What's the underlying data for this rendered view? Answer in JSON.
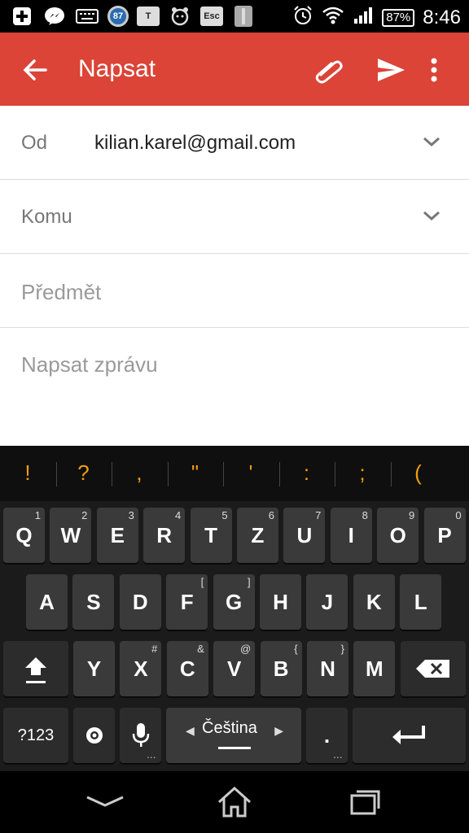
{
  "status_bar": {
    "left_icons": [
      "plus-icon",
      "messenger-icon",
      "keyboard-icon",
      "notification-badge",
      "t-app-icon",
      "alarm-app-icon",
      "esc-key-icon",
      "app-icon"
    ],
    "badge_count": "87",
    "t_label": "T",
    "esc_label": "Esc",
    "battery": "87%",
    "time": "8:46"
  },
  "app_bar": {
    "title": "Napsat",
    "color": "#db4437"
  },
  "compose": {
    "from_label": "Od",
    "from_value": "kilian.karel@gmail.com",
    "to_label": "Komu",
    "subject_placeholder": "Předmět",
    "body_placeholder": "Napsat zprávu"
  },
  "keyboard": {
    "suggestions": [
      "!",
      "?",
      ",",
      "\"",
      "'",
      ":",
      ";",
      "("
    ],
    "row1": [
      {
        "k": "Q",
        "h": "1"
      },
      {
        "k": "W",
        "h": "2"
      },
      {
        "k": "E",
        "h": "3"
      },
      {
        "k": "R",
        "h": "4"
      },
      {
        "k": "T",
        "h": "5"
      },
      {
        "k": "Z",
        "h": "6"
      },
      {
        "k": "U",
        "h": "7"
      },
      {
        "k": "I",
        "h": "8"
      },
      {
        "k": "O",
        "h": "9"
      },
      {
        "k": "P",
        "h": "0"
      }
    ],
    "row2": [
      {
        "k": "A",
        "h": ""
      },
      {
        "k": "S",
        "h": ""
      },
      {
        "k": "D",
        "h": ""
      },
      {
        "k": "F",
        "h": "["
      },
      {
        "k": "G",
        "h": "]"
      },
      {
        "k": "H",
        "h": ""
      },
      {
        "k": "J",
        "h": ""
      },
      {
        "k": "K",
        "h": ""
      },
      {
        "k": "L",
        "h": ""
      }
    ],
    "row3": [
      {
        "k": "Y",
        "h": ""
      },
      {
        "k": "X",
        "h": "#"
      },
      {
        "k": "C",
        "h": "&"
      },
      {
        "k": "V",
        "h": "@"
      },
      {
        "k": "B",
        "h": "{"
      },
      {
        "k": "N",
        "h": "}"
      },
      {
        "k": "M",
        "h": ""
      }
    ],
    "symbols_label": "?123",
    "language_label": "Čeština",
    "period_label": "."
  }
}
